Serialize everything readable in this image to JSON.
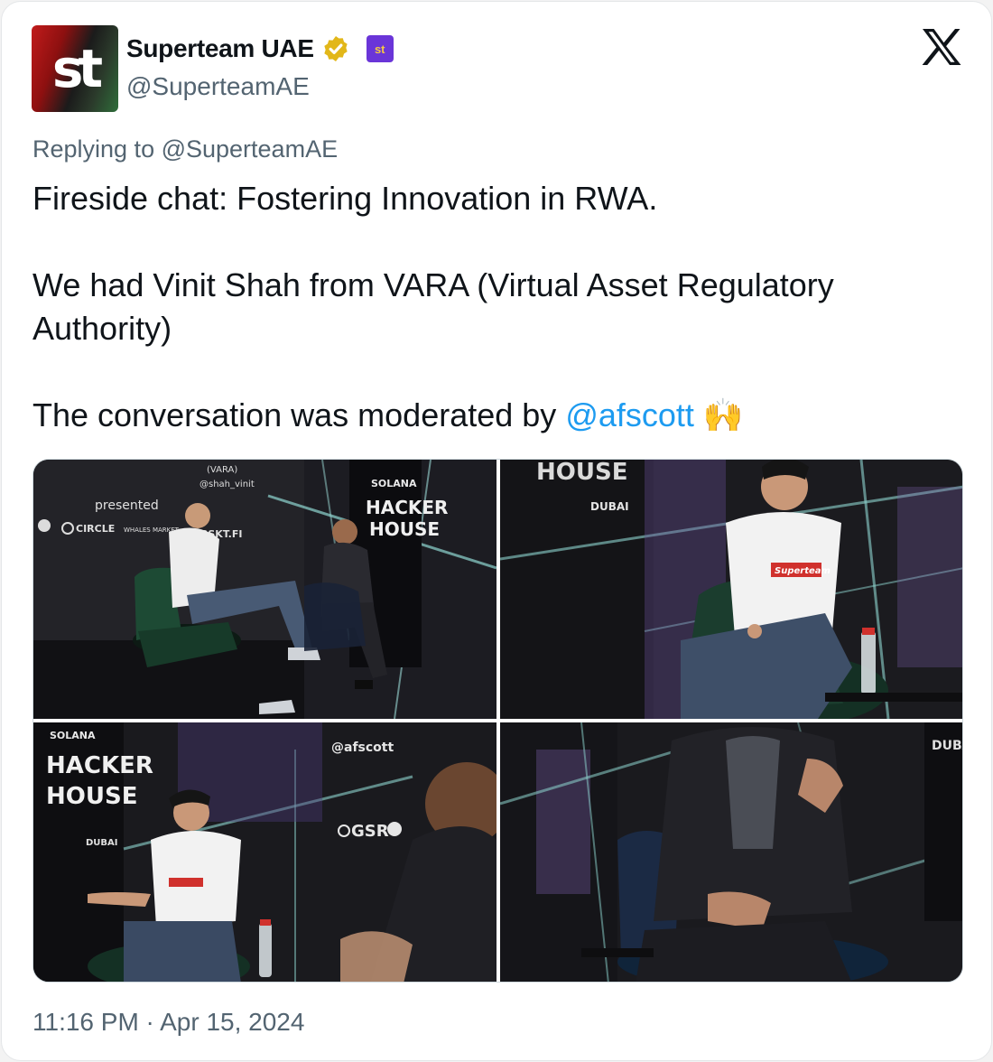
{
  "author": {
    "display_name": "Superteam UAE",
    "handle": "@SuperteamAE",
    "avatar_text": "st",
    "badge_icon": "verified-gold-icon",
    "affiliate_text": "st"
  },
  "platform_icon": "x-logo-icon",
  "reply_to": "Replying to @SuperteamAE",
  "body": {
    "line1": "Fireside chat: Fostering Innovation in RWA.",
    "line2": "We had Vinit Shah from VARA (Virtual Asset Regulatory Authority)",
    "line3_prefix": "The conversation was moderated by ",
    "mention": "@afscott",
    "emoji": "🙌"
  },
  "media": {
    "photo1": {
      "banner_top": "(VARA)",
      "banner_handle": "@shah_vinit",
      "presented": "presented",
      "sponsors": [
        "CIRCLE",
        "WHALES MARKET",
        "BSKT.FI"
      ],
      "stage_title": [
        "SOLANA",
        "HACKER",
        "HOUSE"
      ]
    },
    "photo2": {
      "stage_title": "DUBAI",
      "shirt_text": "Superteam"
    },
    "photo3": {
      "stage_title": [
        "SOLANA",
        "HACKER",
        "HOUSE",
        "DUBAI"
      ],
      "banner_handle": "@afscott",
      "sponsors": [
        "GSR"
      ],
      "shirt_text": "Superteam"
    },
    "photo4": {
      "stage_title": "DUBA"
    }
  },
  "timestamp": "11:16 PM · Apr 15, 2024",
  "colors": {
    "accent": "#1d9bf0",
    "muted": "#536471",
    "text": "#0f1419",
    "badge": "#e2b719",
    "affiliate": "#6a35d8"
  }
}
